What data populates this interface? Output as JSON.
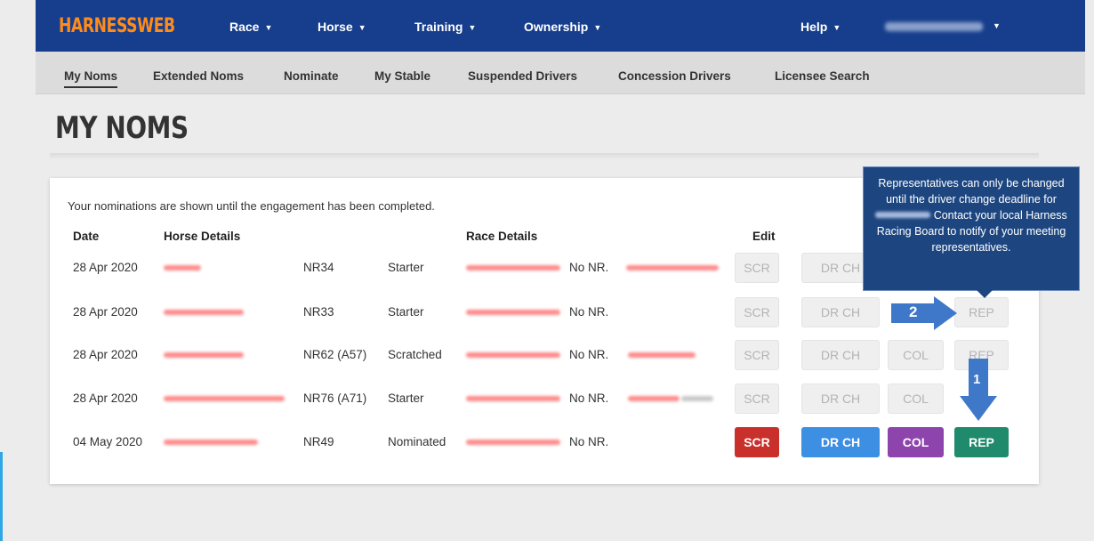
{
  "brand": {
    "name": "HARNESSWEB"
  },
  "topnav": {
    "items": [
      {
        "label": "Race",
        "icon": "caret-down"
      },
      {
        "label": "Horse",
        "icon": "caret-down"
      },
      {
        "label": "Training",
        "icon": "caret-down"
      },
      {
        "label": "Ownership",
        "icon": "caret-down"
      },
      {
        "label": "Help",
        "icon": "caret-down"
      }
    ]
  },
  "subnav": {
    "items": [
      "My Noms",
      "Extended Noms",
      "Nominate",
      "My Stable",
      "Suspended Drivers",
      "Concession Drivers",
      "Licensee Search"
    ],
    "active": "My Noms"
  },
  "page": {
    "title": "MY NOMS"
  },
  "card": {
    "intro": "Your nominations are shown until the engagement has been completed.",
    "headers": {
      "date": "Date",
      "horse": "Horse Details",
      "race": "Race Details",
      "edit": "Edit"
    },
    "rows": [
      {
        "date": "28 Apr 2020",
        "nr": "NR34",
        "status": "Starter",
        "race_nr": "No NR.",
        "scr": "SCR",
        "drch": "DR CH",
        "col": "",
        "rep": "",
        "active": false
      },
      {
        "date": "28 Apr 2020",
        "nr": "NR33",
        "status": "Starter",
        "race_nr": "No NR.",
        "scr": "SCR",
        "drch": "DR CH",
        "col": "",
        "rep": "REP",
        "active": false
      },
      {
        "date": "28 Apr 2020",
        "nr": "NR62 (A57)",
        "status": "Scratched",
        "race_nr": "No NR.",
        "scr": "SCR",
        "drch": "DR CH",
        "col": "COL",
        "rep": "REP",
        "active": false
      },
      {
        "date": "28 Apr 2020",
        "nr": "NR76 (A71)",
        "status": "Starter",
        "race_nr": "No NR.",
        "scr": "SCR",
        "drch": "DR CH",
        "col": "COL",
        "rep": "",
        "active": false
      },
      {
        "date": "04 May 2020",
        "nr": "NR49",
        "status": "Nominated",
        "race_nr": "No NR.",
        "scr": "SCR",
        "drch": "DR CH",
        "col": "COL",
        "rep": "REP",
        "active": true
      }
    ]
  },
  "tooltip": {
    "text_before": "Representatives can only be changed until the driver change deadline for",
    "text_after": "Contact your local Harness Racing Board to notify of your meeting representatives."
  },
  "callouts": {
    "first": "1",
    "second": "2"
  },
  "colors": {
    "nav": "#173e8c",
    "brand": "#ff8c1a",
    "scr": "#c9302c",
    "drch": "#3d8fe3",
    "col": "#8e44ad",
    "rep": "#1f8a6c",
    "tooltip": "#1d4680",
    "callout": "#3f78c9"
  }
}
